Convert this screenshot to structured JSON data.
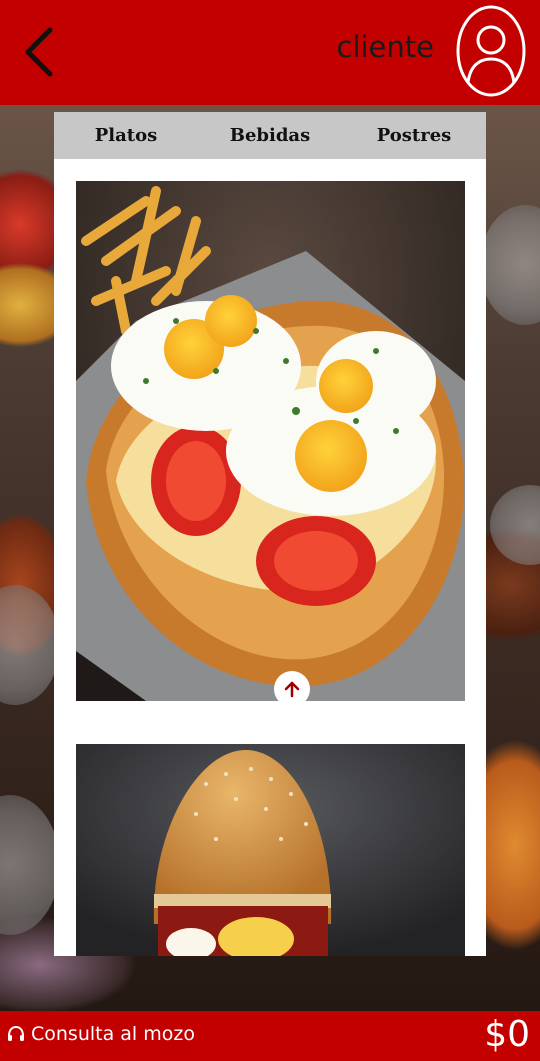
{
  "header": {
    "back_icon": "chevron-left-icon",
    "username": "cliente",
    "avatar_icon": "user-icon"
  },
  "tabs": [
    {
      "label": "Platos"
    },
    {
      "label": "Bebidas"
    },
    {
      "label": "Postres"
    }
  ],
  "menu": {
    "items": [
      {
        "image": "milanesa-with-fried-eggs-and-tomato"
      },
      {
        "image": "burger"
      }
    ],
    "scroll_top_icon": "arrow-up-icon"
  },
  "footer": {
    "waiter_icon": "headset-icon",
    "waiter_label": "Consulta al mozo",
    "total": "$0"
  },
  "colors": {
    "brand": "#c20000",
    "tab_bar": "#c7c7c7"
  }
}
